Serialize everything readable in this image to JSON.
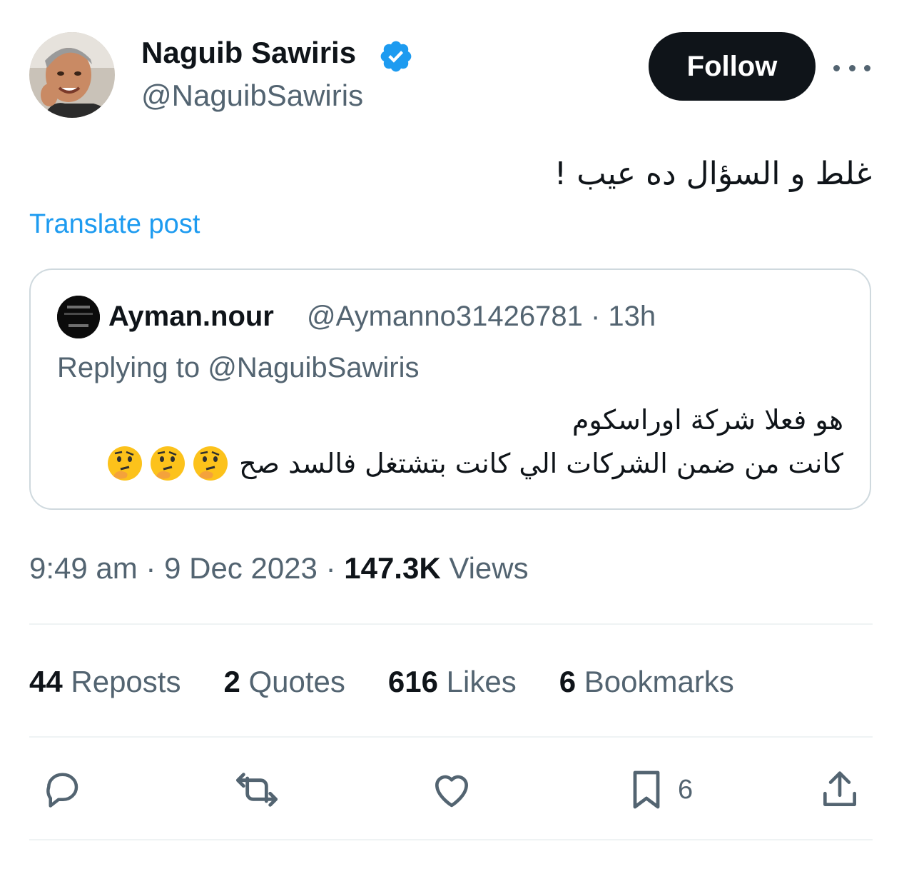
{
  "author": {
    "name": "Naguib Sawiris",
    "handle": "@NaguibSawiris",
    "verified_icon": "verified-badge-icon",
    "accent": "#1d9bf0"
  },
  "follow_label": "Follow",
  "more_icon": "more-horizontal-icon",
  "post": {
    "text": "غلط و السؤال ده عيب !",
    "translate_label": "Translate post"
  },
  "quote": {
    "name": "Ayman.nour",
    "meta": "@Aymanno31426781 · 13h",
    "reply_prefix": "Replying to ",
    "reply_handle": "@NaguibSawiris",
    "line1": "هو فعلا شركة اوراسكوم",
    "line2": "كانت من ضمن الشركات الي كانت بتشتغل فالسد صح"
  },
  "timestamp": {
    "time_date": "9:49 am · 9 Dec 2023 · ",
    "views_count": "147.3K",
    "views_label": " Views"
  },
  "stats": {
    "reposts_count": "44",
    "reposts_label": " Reposts",
    "quotes_count": "2",
    "quotes_label": " Quotes",
    "likes_count": "616",
    "likes_label": " Likes",
    "bookmarks_count": "6",
    "bookmarks_label": " Bookmarks"
  },
  "actions": {
    "reply_icon": "reply-icon",
    "repost_icon": "repost-icon",
    "like_icon": "heart-icon",
    "bookmark_icon": "bookmark-icon",
    "bookmark_count": "6",
    "share_icon": "share-icon"
  }
}
